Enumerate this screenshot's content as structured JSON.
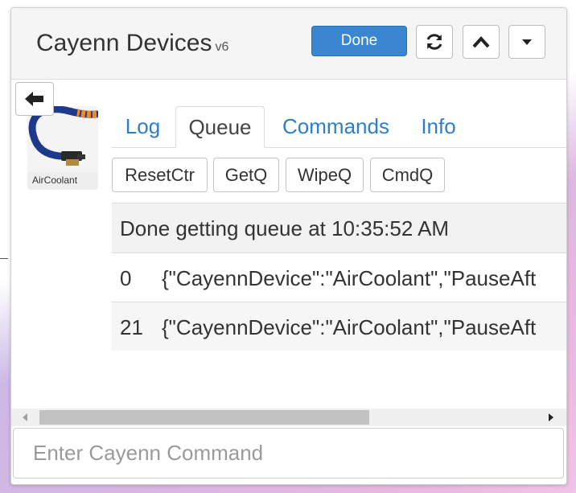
{
  "header": {
    "title": "Cayenn Devices",
    "version": "v6",
    "done_label": "Done",
    "buttons": {
      "refresh_icon": "refresh-icon",
      "up_icon": "chevron-up-icon",
      "dropdown_icon": "caret-down-icon"
    }
  },
  "device": {
    "name": "AirCoolant",
    "back_icon": "arrow-left-icon"
  },
  "tabs": [
    {
      "label": "Log",
      "active": false
    },
    {
      "label": "Queue",
      "active": true
    },
    {
      "label": "Commands",
      "active": false
    },
    {
      "label": "Info",
      "active": false
    }
  ],
  "queue_buttons": [
    {
      "label": "ResetCtr"
    },
    {
      "label": "GetQ"
    },
    {
      "label": "WipeQ"
    },
    {
      "label": "CmdQ"
    }
  ],
  "queue": {
    "status": "Done getting queue at 10:35:52 AM",
    "rows": [
      {
        "index": "0",
        "content": "{\"CayennDevice\":\"AirCoolant\",\"PauseAft"
      },
      {
        "index": "21",
        "content": "{\"CayennDevice\":\"AirCoolant\",\"PauseAft"
      }
    ]
  },
  "command_input": {
    "placeholder": "Enter Cayenn Command",
    "value": ""
  },
  "colors": {
    "accent": "#3a86d0",
    "link": "#2f7ec9"
  }
}
